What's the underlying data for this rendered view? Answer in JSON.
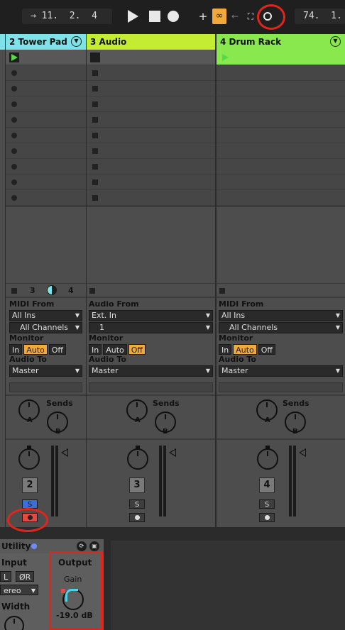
{
  "transport": {
    "position_box": "→ 11.  2.  4",
    "tempo_box": "74.  1.",
    "icons": [
      "follow-icon",
      "play-icon",
      "stop-icon",
      "record-icon",
      "overdub-add-icon",
      "link-icon",
      "back-to-arrangement-icon",
      "punch-icon",
      "loop-icon"
    ]
  },
  "tracks": [
    {
      "name": "2 Tower Pad",
      "color": "#7ee3e8",
      "stop_count_left": "3",
      "stop_count_right": "4",
      "io_from_label": "MIDI From",
      "io_from": "All Ins",
      "io_channel": "All Channels",
      "monitor_label": "Monitor",
      "monitor": [
        "In",
        "Auto",
        "Off"
      ],
      "monitor_active": "Auto",
      "audio_to_label": "Audio To",
      "audio_to": "Master",
      "sends_label": "Sends",
      "send_a": "A",
      "send_b": "B",
      "track_number": "2",
      "solo": "S"
    },
    {
      "name": "3 Audio",
      "color": "#c4ec33",
      "io_from_label": "Audio From",
      "io_from": "Ext. In",
      "io_channel": "1",
      "monitor_label": "Monitor",
      "monitor": [
        "In",
        "Auto",
        "Off"
      ],
      "monitor_active": "Off",
      "audio_to_label": "Audio To",
      "audio_to": "Master",
      "sends_label": "Sends",
      "send_a": "A",
      "send_b": "B",
      "track_number": "3",
      "solo": "S"
    },
    {
      "name": "4 Drum Rack",
      "color": "#89e84e",
      "io_from_label": "MIDI From",
      "io_from": "All Ins",
      "io_channel": "All Channels",
      "monitor_label": "Monitor",
      "monitor": [
        "In",
        "Auto",
        "Off"
      ],
      "monitor_active": "Auto",
      "audio_to_label": "Audio To",
      "audio_to": "Master",
      "sends_label": "Sends",
      "send_a": "A",
      "send_b": "B",
      "track_number": "4",
      "solo": "S"
    }
  ],
  "device": {
    "title": "Utility",
    "input_label": "Input",
    "left_btn": "L",
    "phase_r_btn": "ØR",
    "mode": "ereo",
    "width_label": "Width",
    "output_label": "Output",
    "gain_label": "Gain",
    "gain_value": "-19.0 dB"
  },
  "colors": {
    "annotation": "#e0261b",
    "monitor_active": "#f2a93b",
    "solo_active": "#3a6fd8",
    "arm_active": "#e34a44"
  }
}
